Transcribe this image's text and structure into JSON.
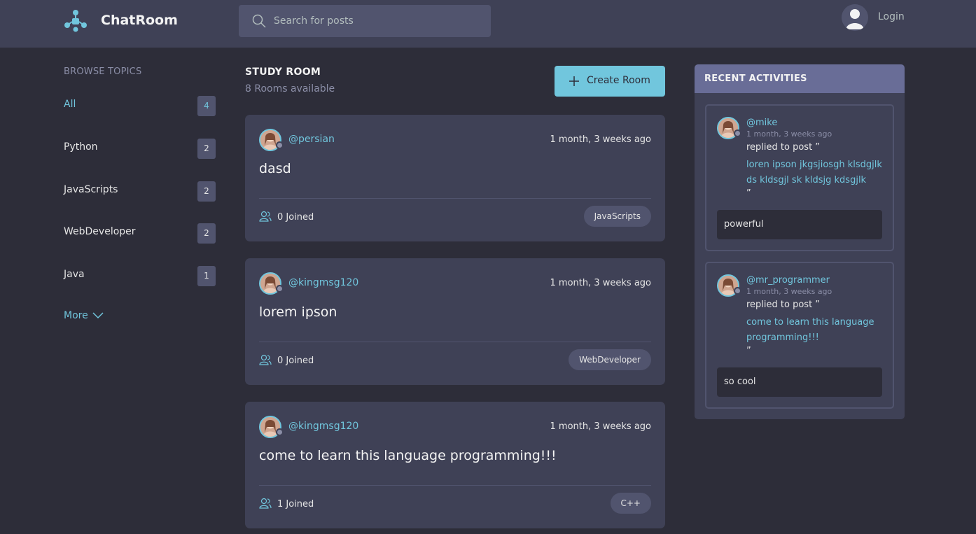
{
  "header": {
    "brand": "ChatRoom",
    "search_placeholder": "Search for posts",
    "login_label": "Login"
  },
  "topics": {
    "title": "BROWSE TOPICS",
    "items": [
      {
        "label": "All",
        "count": "4"
      },
      {
        "label": "Python",
        "count": "2"
      },
      {
        "label": "JavaScripts",
        "count": "2"
      },
      {
        "label": "WebDeveloper",
        "count": "2"
      },
      {
        "label": "Java",
        "count": "1"
      }
    ],
    "more_label": "More"
  },
  "rooms": {
    "title": "STUDY ROOM",
    "available": "8 Rooms available",
    "create_label": "Create Room",
    "cards": [
      {
        "host": "@persian",
        "time": "1 month, 3 weeks ago",
        "name": "dasd",
        "joined": "0 Joined",
        "topic": "JavaScripts"
      },
      {
        "host": "@kingmsg120",
        "time": "1 month, 3 weeks ago",
        "name": "lorem ipson",
        "joined": "0 Joined",
        "topic": "WebDeveloper"
      },
      {
        "host": "@kingmsg120",
        "time": "1 month, 3 weeks ago",
        "name": "come to learn this language programming!!!",
        "joined": "1 Joined",
        "topic": "C++"
      }
    ]
  },
  "activities": {
    "title": "RECENT ACTIVITIES",
    "items": [
      {
        "user": "@mike",
        "time": "1 month, 3 weeks ago",
        "action": "replied to post ”",
        "post": "loren ipson jkgsjiosgh klsdgjlk ds kldsgjl sk kldsjg kdsgjlk",
        "quote_end": "”",
        "reply": "powerful"
      },
      {
        "user": "@mr_programmer",
        "time": "1 month, 3 weeks ago",
        "action": "replied to post ”",
        "post": "come to learn this language programming!!!",
        "quote_end": "”",
        "reply": "so cool"
      }
    ]
  },
  "colors": {
    "accent": "#71c6dd",
    "header_bg": "#3f4156",
    "page_bg": "#2d2d39",
    "card_bg": "#3f4156",
    "activity_header_bg": "#696d97"
  },
  "icons": {
    "logo": "chatroom-logo-icon",
    "search": "search-icon",
    "user": "user-avatar-icon",
    "more": "chevron-down-icon",
    "plus": "plus-icon",
    "joined": "users-icon"
  }
}
